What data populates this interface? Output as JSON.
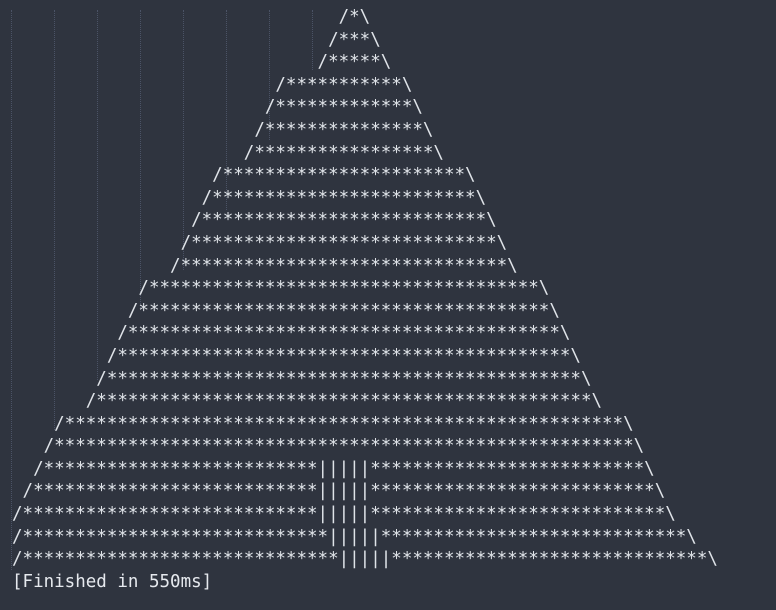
{
  "colors": {
    "background": "#2f343f",
    "text": "#dfe3e8",
    "indent_guide": "#4b5366"
  },
  "console": {
    "lines": [
      "                               /*\\",
      "                              /***\\",
      "                             /*****\\",
      "                         /***********\\",
      "                        /*************\\",
      "                       /***************\\",
      "                      /*****************\\",
      "                   /***********************\\",
      "                  /*************************\\",
      "                 /***************************\\",
      "                /*****************************\\",
      "               /*******************************\\",
      "            /*************************************\\",
      "           /***************************************\\",
      "          /*****************************************\\",
      "         /*******************************************\\",
      "        /*********************************************\\",
      "       /***********************************************\\",
      "    /*****************************************************\\",
      "   /*******************************************************\\",
      "  /**************************|||||**************************\\",
      " /***************************|||||***************************\\",
      "/****************************|||||****************************\\",
      "/*****************************|||||*****************************\\",
      "/******************************|||||******************************\\"
    ],
    "status": "[Finished in 550ms]"
  }
}
